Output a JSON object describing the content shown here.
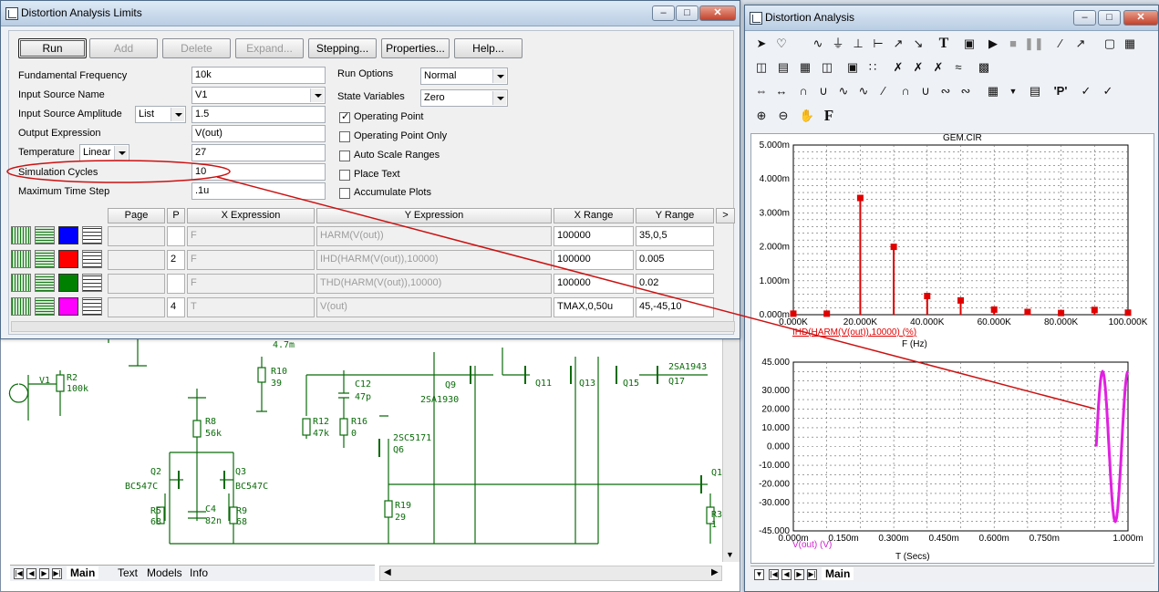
{
  "dialog": {
    "title": "Distortion Analysis Limits",
    "buttons": {
      "run": "Run",
      "add": "Add",
      "delete": "Delete",
      "expand": "Expand...",
      "stepping": "Stepping...",
      "properties": "Properties...",
      "help": "Help..."
    },
    "fields": {
      "fundamental_frequency": {
        "label": "Fundamental Frequency",
        "value": "10k"
      },
      "input_source_name": {
        "label": "Input Source Name",
        "value": "V1"
      },
      "input_source_amplitude": {
        "label": "Input Source Amplitude",
        "mode": "List",
        "value": "1.5"
      },
      "output_expression": {
        "label": "Output Expression",
        "value": "V(out)"
      },
      "temperature": {
        "label": "Temperature",
        "mode": "Linear",
        "value": "27"
      },
      "simulation_cycles": {
        "label": "Simulation Cycles",
        "value": "10"
      },
      "maximum_time_step": {
        "label": "Maximum Time Step",
        "value": ".1u"
      }
    },
    "run_options": {
      "label": "Run Options",
      "value": "Normal"
    },
    "state_variables": {
      "label": "State Variables",
      "value": "Zero"
    },
    "checks": [
      {
        "label": "Operating Point",
        "checked": true
      },
      {
        "label": "Operating Point Only",
        "checked": false
      },
      {
        "label": "Auto Scale Ranges",
        "checked": false
      },
      {
        "label": "Place Text",
        "checked": false
      },
      {
        "label": "Accumulate Plots",
        "checked": false
      }
    ],
    "grid": {
      "headers": [
        "Page",
        "P",
        "X Expression",
        "Y Expression",
        "X Range",
        "Y Range",
        ">"
      ],
      "rows": [
        {
          "color": "#0000ff",
          "p": "",
          "x": "F",
          "y": "HARM(V(out))",
          "xr": "100000",
          "yr": "35,0,5"
        },
        {
          "color": "#ff0000",
          "p": "2",
          "x": "F",
          "y": "IHD(HARM(V(out)),10000)",
          "xr": "100000",
          "yr": "0.005"
        },
        {
          "color": "#008000",
          "p": "",
          "x": "F",
          "y": "THD(HARM(V(out)),10000)",
          "xr": "100000",
          "yr": "0.02"
        },
        {
          "color": "#ff00ff",
          "p": "4",
          "x": "T",
          "y": "V(out)",
          "xr": "TMAX,0,50u",
          "yr": "45,-45,10"
        }
      ]
    }
  },
  "schematic": {
    "labels": [
      "V1",
      "R2",
      "100k",
      "R10",
      "39",
      "4.7m",
      "C12",
      "47p",
      "R12",
      "47k",
      "R16",
      "0",
      "Q9",
      "2SA1930",
      "Q11",
      "Q13",
      "Q15",
      "Q17",
      "2SA1943",
      "2SC5171",
      "Q6",
      "R8",
      "56k",
      "Q2",
      "Q3",
      "BC547C",
      "BC547C",
      "R5",
      "68",
      "C4",
      "82n",
      "R9",
      "68",
      "R19",
      "29",
      "Q1",
      "R3",
      "1"
    ],
    "tabs": [
      "Main",
      "Text",
      "Models",
      "Info"
    ]
  },
  "analysis": {
    "title": "Distortion Analysis",
    "tab": "Main",
    "chart_data": [
      {
        "type": "bar",
        "title": "GEM.CIR",
        "xlabel": "F (Hz)",
        "ylabel": "IHD(HARM(V(out)),10000) (%)",
        "x": [
          0,
          10000,
          20000,
          30000,
          40000,
          50000,
          60000,
          70000,
          80000,
          90000,
          100000
        ],
        "values": [
          3e-05,
          3e-05,
          0.00344,
          0.002,
          0.00055,
          0.00042,
          0.00015,
          8e-05,
          5e-05,
          0.00014,
          6e-05
        ],
        "xlim": [
          0,
          100000
        ],
        "ylim": [
          0,
          0.005
        ],
        "xticks": [
          "0.000K",
          "20.000K",
          "40.000K",
          "60.000K",
          "80.000K",
          "100.000K"
        ],
        "yticks": [
          "0.000m",
          "1.000m",
          "2.000m",
          "3.000m",
          "4.000m",
          "5.000m"
        ],
        "color": "#e00000"
      },
      {
        "type": "line",
        "xlabel": "T (Secs)",
        "ylabel": "V(out) (V)",
        "xlim": [
          0,
          1e-06
        ],
        "ylim": [
          -45,
          45
        ],
        "xticks": [
          "0.000m",
          "0.150m",
          "0.300m",
          "0.450m",
          "0.600m",
          "0.750m",
          "1.000m"
        ],
        "yticks": [
          "45.000",
          "30.000",
          "20.000",
          "10.000",
          "0.000",
          "-10.000",
          "-20.000",
          "-30.000",
          "-45.000"
        ],
        "color": "#e020e0"
      }
    ]
  }
}
